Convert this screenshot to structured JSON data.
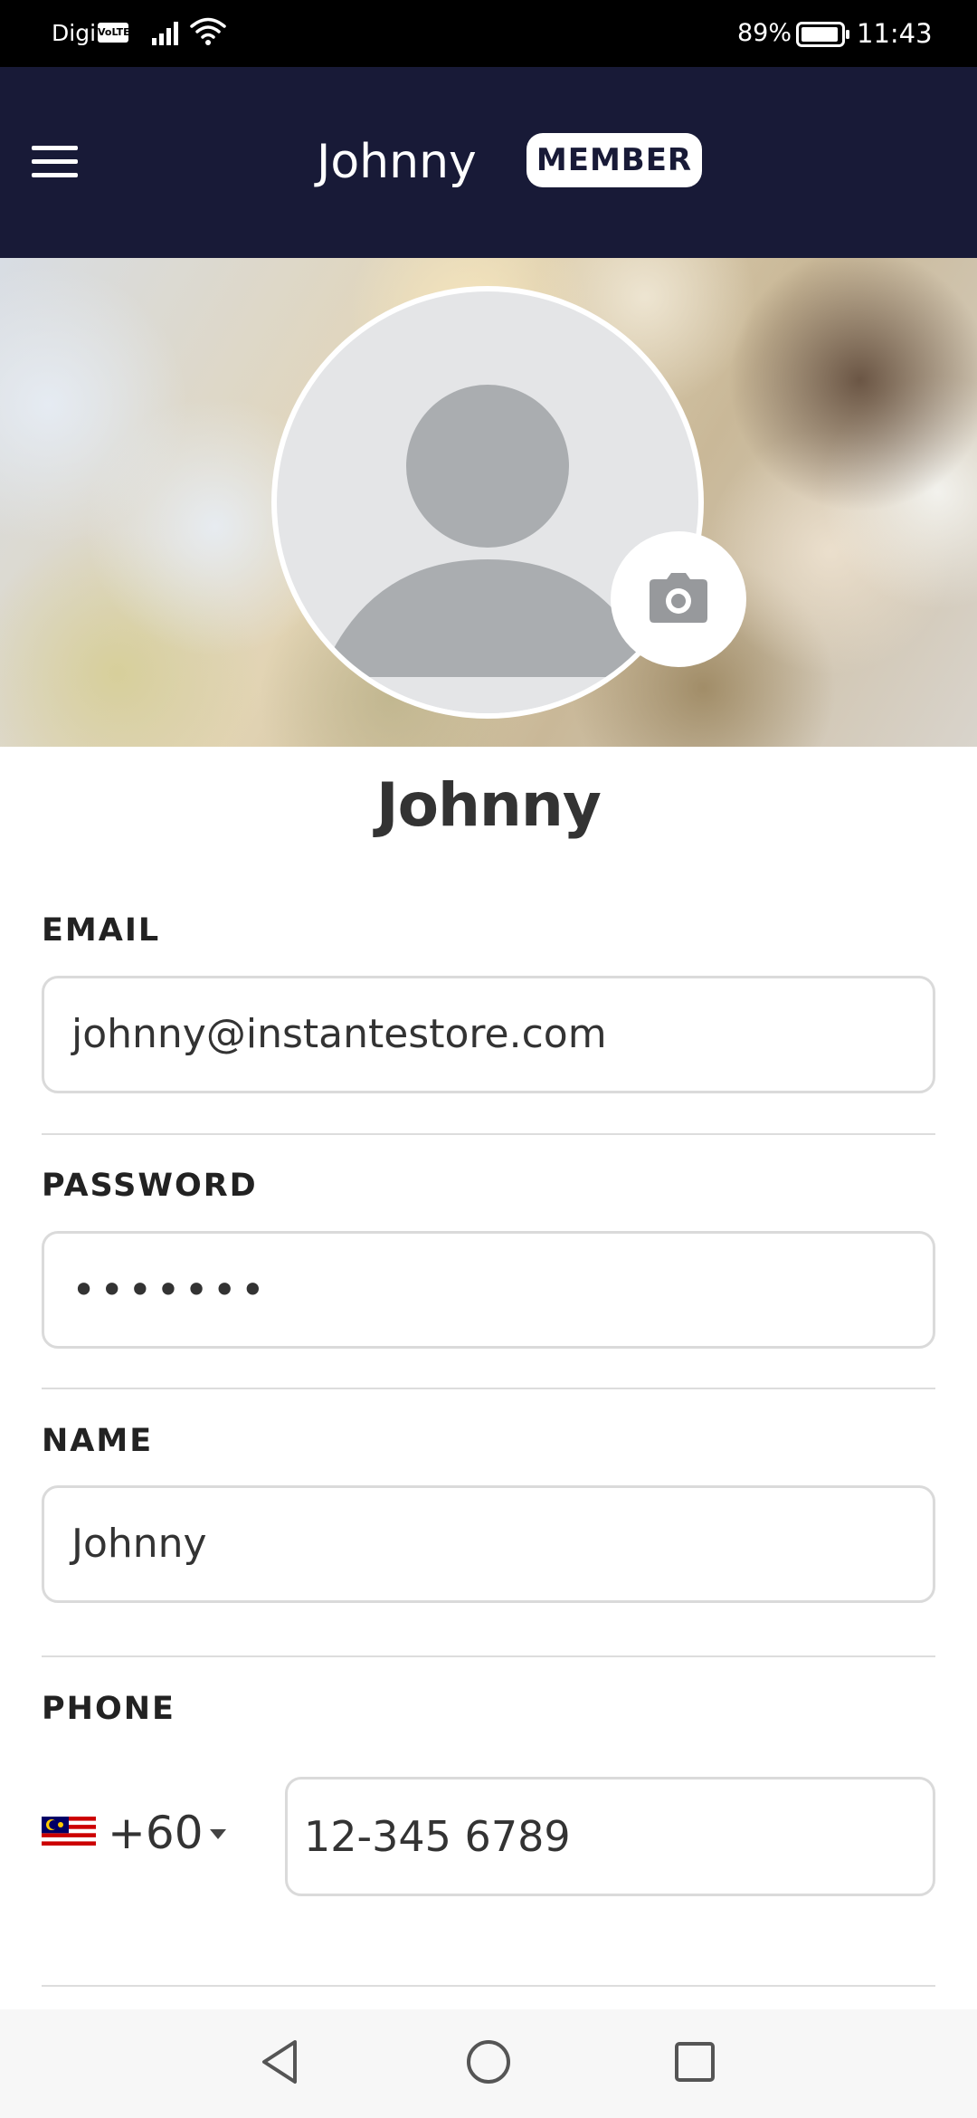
{
  "status_bar": {
    "carrier": "Digi",
    "network_badge": "VoLTE",
    "battery_percent": "89%",
    "time": "11:43",
    "signal_icon": "cellular-signal-icon",
    "wifi_icon": "wifi-icon",
    "battery_icon": "battery-icon"
  },
  "header": {
    "menu_icon": "hamburger-menu-icon",
    "title": "Johnny",
    "badge": "MEMBER",
    "background_color": "#181a37"
  },
  "profile": {
    "avatar_icon": "default-avatar-icon",
    "camera_icon": "camera-icon",
    "name": "Johnny"
  },
  "form": {
    "email": {
      "label": "EMAIL",
      "value": "johnny@instantestore.com"
    },
    "password": {
      "label": "PASSWORD",
      "value": "•••••••"
    },
    "name": {
      "label": "NAME",
      "value": "Johnny"
    },
    "phone": {
      "label": "PHONE",
      "country_flag": "malaysia-flag-icon",
      "country_code": "+60",
      "value": "12-345 6789"
    }
  },
  "nav_bar": {
    "back_icon": "back-triangle-icon",
    "home_icon": "home-circle-icon",
    "recents_icon": "recents-square-icon"
  }
}
